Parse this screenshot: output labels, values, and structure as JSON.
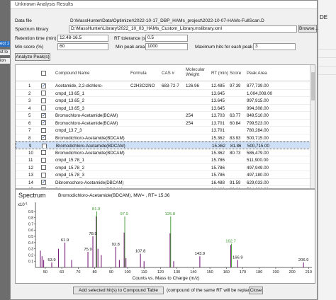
{
  "background": {
    "left_strips": [
      "ect 1",
      "st lo",
      "ion"
    ],
    "right_text": "DE"
  },
  "dialog": {
    "title": "Unknown Analysis Results",
    "data_file_label": "Data file",
    "data_file_value": "D:\\MassHunter\\Data\\Optimizer\\2022-10-17_DBP_HAMs_project\\2022-10-07-HAMs-FullScan.D",
    "library_label": "Spectrum library",
    "library_value": "D:\\MassHunter\\Library\\2022_10_03_HAMs_Custom_Library.mslibrary.xml",
    "browse_label": "Browse...",
    "rt_range_label": "Retention time (min)",
    "rt_range_value": "12.48-16.5",
    "rt_tol_label": "RT tolerance (sec)",
    "rt_tol_value": "0.5",
    "min_score_label": "Min score (%)",
    "min_score_value": "60",
    "min_peak_label": "Min peak area",
    "min_peak_value": "1000",
    "max_hits_label": "Maximum hits for each peak",
    "max_hits_value": "3",
    "analyze_label": "Analyze Peak(s)"
  },
  "table": {
    "headers": {
      "num": "",
      "check": "",
      "name": "Compound Name",
      "formula": "Formula",
      "cas": "CAS #",
      "mw": "Molecular Weight",
      "rt": "RT (min)",
      "score": "Score",
      "area": "Peak Area"
    },
    "rows": [
      {
        "num": "1",
        "checked": true,
        "name": "Acetamide, 2,2-dichloro-",
        "formula": "C2H3Cl2NO",
        "cas": "683-72-7",
        "mw": "126.96",
        "rt": "12.485",
        "score": "97.39",
        "area": "877,739.00"
      },
      {
        "num": "2",
        "checked": false,
        "name": "cmpd_13.65_1",
        "formula": "",
        "cas": "",
        "mw": "",
        "rt": "13.645",
        "score": "",
        "area": "1,004,008.00"
      },
      {
        "num": "3",
        "checked": false,
        "name": "cmpd_13.65_2",
        "formula": "",
        "cas": "",
        "mw": "",
        "rt": "13.645",
        "score": "",
        "area": "997,915.00"
      },
      {
        "num": "4",
        "checked": false,
        "name": "cmpd_13.65_3",
        "formula": "",
        "cas": "",
        "mw": "",
        "rt": "13.645",
        "score": "",
        "area": "994,308.00"
      },
      {
        "num": "5",
        "checked": true,
        "name": "Bromochloro-Acetamide(BCAM)",
        "formula": "",
        "cas": "",
        "mw": "254",
        "rt": "13.703",
        "score": "63.77",
        "area": "849,510.00"
      },
      {
        "num": "6",
        "checked": true,
        "name": "Bromochloro-Acetamide(BCAM)",
        "formula": "",
        "cas": "",
        "mw": "254",
        "rt": "13.701",
        "score": "60.84",
        "area": "799,523.00"
      },
      {
        "num": "7",
        "checked": false,
        "name": "cmpd_13.7_3",
        "formula": "",
        "cas": "",
        "mw": "",
        "rt": "13.701",
        "score": "",
        "area": "780,284.00"
      },
      {
        "num": "8",
        "checked": true,
        "name": "Bromodichloro-Acetamide(BDCAM)",
        "formula": "",
        "cas": "",
        "mw": "",
        "rt": "15.362",
        "score": "83.93",
        "area": "500,715.00"
      },
      {
        "num": "9",
        "checked": false,
        "name": "Bromodichloro-Acetamide(BDCAM)",
        "formula": "",
        "cas": "",
        "mw": "",
        "rt": "15.362",
        "score": "81.86",
        "area": "500,715.00",
        "selected": true
      },
      {
        "num": "10",
        "checked": false,
        "name": "Bromodichloro-Acetamide(BDCAM)",
        "formula": "",
        "cas": "",
        "mw": "",
        "rt": "15.362",
        "score": "80.73",
        "area": "586,479.00"
      },
      {
        "num": "11",
        "checked": false,
        "name": "cmpd_15.78_1",
        "formula": "",
        "cas": "",
        "mw": "",
        "rt": "15.786",
        "score": "",
        "area": "511,900.00"
      },
      {
        "num": "12",
        "checked": false,
        "name": "cmpd_15.78_2",
        "formula": "",
        "cas": "",
        "mw": "",
        "rt": "15.786",
        "score": "",
        "area": "497,949.00"
      },
      {
        "num": "13",
        "checked": false,
        "name": "cmpd_15.78_3",
        "formula": "",
        "cas": "",
        "mw": "",
        "rt": "15.786",
        "score": "",
        "area": "497,180.00"
      },
      {
        "num": "14",
        "checked": true,
        "name": "Dibromochoro-Acetamide(DBCAM)",
        "formula": "",
        "cas": "",
        "mw": "",
        "rt": "16.488",
        "score": "91.59",
        "area": "629,033.00"
      },
      {
        "num": "15",
        "checked": false,
        "name": "Dibromochoro-Acetamide(DBCAM)",
        "formula": "",
        "cas": "",
        "mw": "",
        "rt": "16.488",
        "score": "90.61",
        "area": "594,693.00"
      }
    ]
  },
  "spectrum": {
    "title": "Spectrum",
    "info": "Bromodichloro-Acetamide(BDCAM), MW= , RT= 15.36",
    "xlabel": "Counts vs. Mass to Charge (m/z)",
    "y_exp": "x10",
    "y_exp_sup": "-1",
    "colors": {
      "sample": "#7a1e7a",
      "library": "#3c9a2c"
    }
  },
  "chart_data": {
    "type": "bar",
    "title": "",
    "xlabel": "Counts vs. Mass to Charge (m/z)",
    "ylabel": "",
    "xlim": [
      44,
      212
    ],
    "ylim": [
      0,
      1.0
    ],
    "x_ticks": [
      50,
      60,
      70,
      80,
      90,
      100,
      110,
      120,
      130,
      140,
      150,
      160,
      170,
      180,
      190,
      200,
      210
    ],
    "y_ticks": [
      0.1,
      0.2,
      0.3,
      0.4,
      0.5,
      0.6,
      0.7,
      0.8,
      0.9
    ],
    "series": [
      {
        "color": "#7a1e7a",
        "values": [
          {
            "x": 47,
            "y": 0.27
          },
          {
            "x": 48,
            "y": 0.18
          },
          {
            "x": 49,
            "y": 0.12
          },
          {
            "x": 53.9,
            "y": 0.08
          },
          {
            "x": 58,
            "y": 0.3
          },
          {
            "x": 61.9,
            "y": 0.4
          },
          {
            "x": 66,
            "y": 0.12
          },
          {
            "x": 75.9,
            "y": 0.25
          },
          {
            "x": 78.9,
            "y": 0.5
          },
          {
            "x": 80.9,
            "y": 0.82
          },
          {
            "x": 82,
            "y": 0.3
          },
          {
            "x": 84,
            "y": 0.2
          },
          {
            "x": 92.8,
            "y": 0.33
          },
          {
            "x": 95,
            "y": 0.12
          },
          {
            "x": 97.9,
            "y": 0.56
          },
          {
            "x": 99,
            "y": 0.15
          },
          {
            "x": 107.8,
            "y": 0.22
          },
          {
            "x": 110,
            "y": 0.1
          },
          {
            "x": 125.8,
            "y": 0.55
          },
          {
            "x": 128,
            "y": 0.1
          },
          {
            "x": 143.9,
            "y": 0.18
          },
          {
            "x": 162.7,
            "y": 0.36
          },
          {
            "x": 166.9,
            "y": 0.12
          },
          {
            "x": 206.9,
            "y": 0.08
          }
        ]
      },
      {
        "color": "#3c9a2c",
        "values": [
          {
            "x": 80.9,
            "y": 0.9
          },
          {
            "x": 97.9,
            "y": 0.82
          },
          {
            "x": 125.8,
            "y": 0.82
          },
          {
            "x": 162.7,
            "y": 0.38
          }
        ]
      }
    ],
    "peak_labels": [
      {
        "x": 53.9,
        "y": 0.08,
        "text": "53.9",
        "color": "#111"
      },
      {
        "x": 61.9,
        "y": 0.4,
        "text": "61.9",
        "color": "#111"
      },
      {
        "x": 75.9,
        "y": 0.25,
        "text": "75.9",
        "color": "#111"
      },
      {
        "x": 78.9,
        "y": 0.5,
        "text": "78.9",
        "color": "#111"
      },
      {
        "x": 80.9,
        "y": 0.9,
        "text": "81.9",
        "color": "#3c9a2c"
      },
      {
        "x": 92.8,
        "y": 0.33,
        "text": "92.8",
        "color": "#111"
      },
      {
        "x": 97.9,
        "y": 0.82,
        "text": "97.9",
        "color": "#3c9a2c"
      },
      {
        "x": 107.8,
        "y": 0.22,
        "text": "107.8",
        "color": "#111"
      },
      {
        "x": 125.8,
        "y": 0.82,
        "text": "125.8",
        "color": "#3c9a2c"
      },
      {
        "x": 143.9,
        "y": 0.18,
        "text": "143.9",
        "color": "#111"
      },
      {
        "x": 162.7,
        "y": 0.38,
        "text": "162.7",
        "color": "#3c9a2c"
      },
      {
        "x": 166.9,
        "y": 0.12,
        "text": "166.9",
        "color": "#111"
      },
      {
        "x": 206.9,
        "y": 0.08,
        "text": "206.9",
        "color": "#111"
      }
    ]
  },
  "footer": {
    "add_label": "Add selected hit(s) to Compound Table",
    "note": "(compound of the same RT will be replaced)",
    "close_label": "Close"
  }
}
